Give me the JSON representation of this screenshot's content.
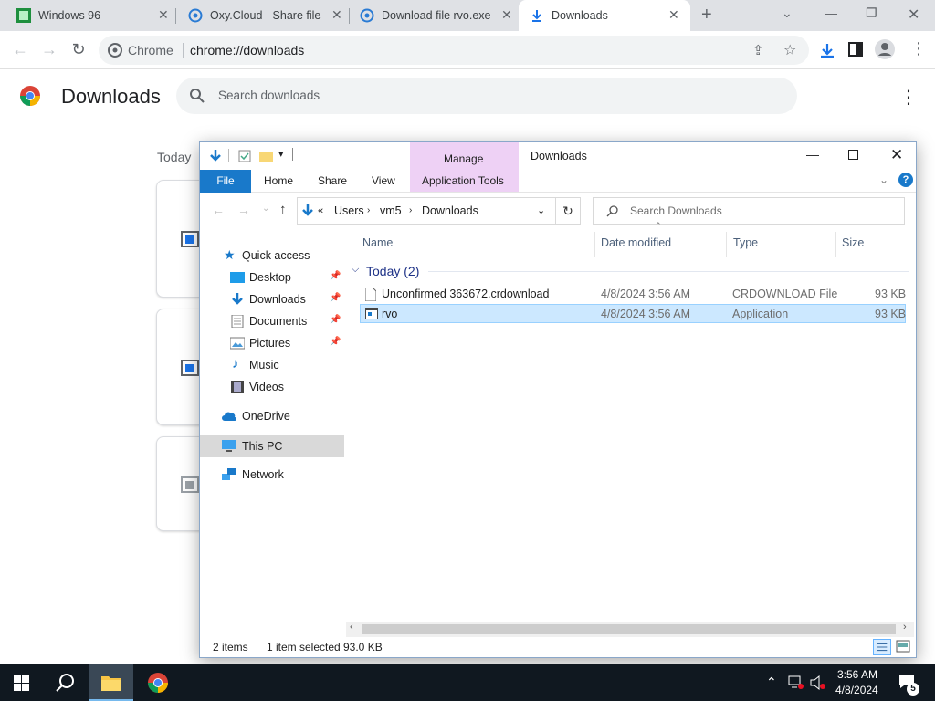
{
  "browser": {
    "tabs": [
      {
        "title": "Windows 96",
        "favicon": "windows96-icon"
      },
      {
        "title": "Oxy.Cloud - Share files",
        "favicon": "oxycloud-icon"
      },
      {
        "title": "Download file rvo.exe",
        "favicon": "oxycloud-icon"
      },
      {
        "title": "Downloads",
        "favicon": "download-arrow-icon"
      }
    ],
    "new_tab": "+",
    "omnibox_chip": "Chrome",
    "url": "chrome://downloads"
  },
  "downloads_page": {
    "title": "Downloads",
    "search_placeholder": "Search downloads",
    "section_label": "Today"
  },
  "explorer": {
    "window_title": "Downloads",
    "ribbon": {
      "file": "File",
      "home": "Home",
      "share": "Share",
      "view": "View",
      "manage": "Manage",
      "app_tools": "Application Tools"
    },
    "address": {
      "overflow": "«",
      "crumbs": [
        "Users",
        "vm5",
        "Downloads"
      ]
    },
    "search_placeholder": "Search Downloads",
    "nav": [
      {
        "label": "Quick access",
        "icon": "star-icon"
      },
      {
        "label": "Desktop",
        "icon": "desktop-icon",
        "pinned": true
      },
      {
        "label": "Downloads",
        "icon": "download-arrow-icon",
        "pinned": true
      },
      {
        "label": "Documents",
        "icon": "documents-icon",
        "pinned": true
      },
      {
        "label": "Pictures",
        "icon": "pictures-icon",
        "pinned": true
      },
      {
        "label": "Music",
        "icon": "music-icon"
      },
      {
        "label": "Videos",
        "icon": "videos-icon"
      },
      {
        "label": "OneDrive",
        "icon": "cloud-icon"
      },
      {
        "label": "This PC",
        "icon": "computer-icon"
      },
      {
        "label": "Network",
        "icon": "network-icon"
      }
    ],
    "columns": [
      "Name",
      "Date modified",
      "Type",
      "Size"
    ],
    "group_label": "Today (2)",
    "files": [
      {
        "name": "Unconfirmed 363672.crdownload",
        "date": "4/8/2024 3:56 AM",
        "type": "CRDOWNLOAD File",
        "size": "93 KB"
      },
      {
        "name": "rvo",
        "date": "4/8/2024 3:56 AM",
        "type": "Application",
        "size": "93 KB"
      }
    ],
    "status": {
      "count": "2 items",
      "selected": "1 item selected",
      "selected_size": "93.0 KB"
    }
  },
  "taskbar": {
    "time": "3:56 AM",
    "date": "4/8/2024",
    "notifications": "5"
  },
  "colors": {
    "accent": "#1979ca",
    "selection": "#cce8ff",
    "taskbar": "#101820"
  }
}
